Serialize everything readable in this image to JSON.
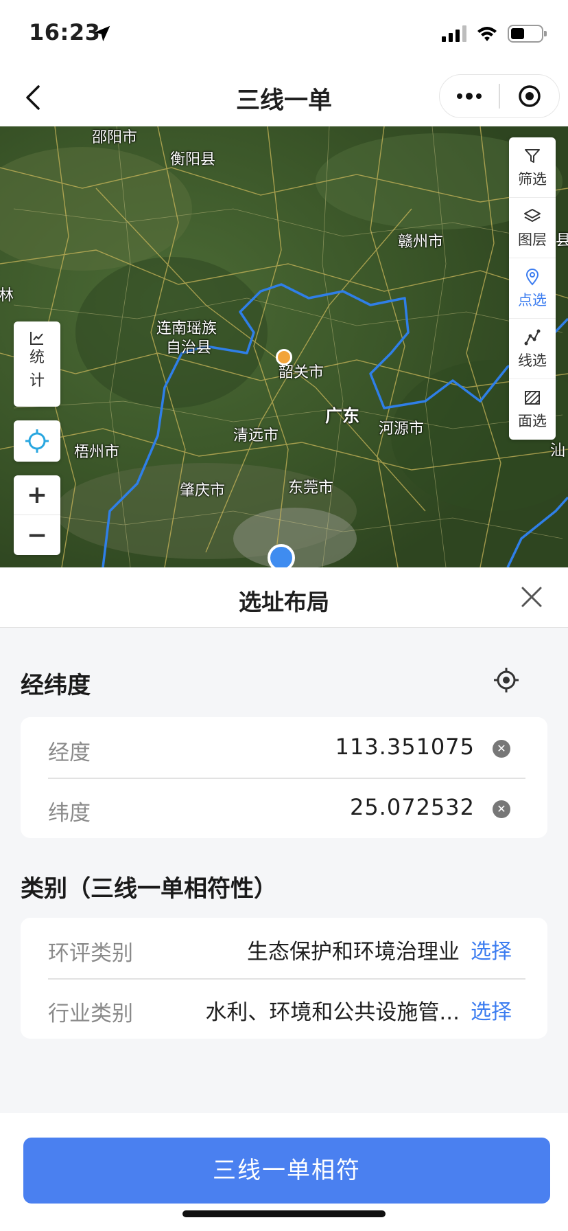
{
  "status_bar": {
    "time": "16:23"
  },
  "nav": {
    "title": "三线一单"
  },
  "map": {
    "cities": [
      {
        "key": "shaoyang",
        "name": "邵阳市"
      },
      {
        "key": "hengyang",
        "name": "衡阳县"
      },
      {
        "key": "ganzhou",
        "name": "赣州市"
      },
      {
        "key": "liannan_1",
        "name": "连南瑶族"
      },
      {
        "key": "liannan_2",
        "name": "自治县"
      },
      {
        "key": "shaoguan",
        "name": "韶关市"
      },
      {
        "key": "guangdong",
        "name": "广东"
      },
      {
        "key": "qingyuan",
        "name": "清远市"
      },
      {
        "key": "heyuan",
        "name": "河源市"
      },
      {
        "key": "wuzhou",
        "name": "梧州市"
      },
      {
        "key": "zhaoqing",
        "name": "肇庆市"
      },
      {
        "key": "dongguan",
        "name": "东莞市"
      },
      {
        "key": "shan",
        "name": "汕"
      },
      {
        "key": "xian",
        "name": "县"
      },
      {
        "key": "lin",
        "name": "林"
      }
    ],
    "tools": [
      {
        "label": "筛选",
        "icon": "filter-icon"
      },
      {
        "label": "图层",
        "icon": "layers-icon"
      },
      {
        "label": "点选",
        "icon": "pin-icon",
        "active": true
      },
      {
        "label": "线选",
        "icon": "polyline-icon"
      },
      {
        "label": "面选",
        "icon": "polygon-icon"
      }
    ],
    "stats_label_1": "统",
    "stats_label_2": "计",
    "zoom_in": "+",
    "zoom_out": "−",
    "border_color": "#2f7fe8"
  },
  "sheet": {
    "title": "选址布局",
    "coords_section_title": "经纬度",
    "longitude_label": "经度",
    "longitude_value": "113.351075",
    "latitude_label": "纬度",
    "latitude_value": "25.072532",
    "category_section_title": "类别（三线一单相符性）",
    "eia_label": "环评类别",
    "eia_value": "生态保护和环境治理业",
    "eia_select": "选择",
    "industry_label": "行业类别",
    "industry_value": "水利、环境和公共设施管...",
    "industry_select": "选择"
  },
  "footer": {
    "button_label": "三线一单相符"
  },
  "colors": {
    "accent": "#4a80f0",
    "link": "#3b7cf0",
    "pin_orange": "#f2a43a"
  }
}
